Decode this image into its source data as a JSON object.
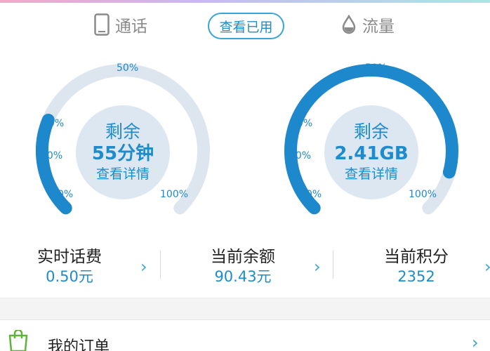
{
  "header": {
    "call_tab": {
      "label": "通话",
      "icon": "phone-icon"
    },
    "view_used_button": "查看已用",
    "data_tab": {
      "label": "流量",
      "icon": "droplet-icon"
    }
  },
  "colors": {
    "accent": "#1e88cc",
    "track": "#dde6ef",
    "center": "#dce7f1"
  },
  "gauges": [
    {
      "title": "剩余",
      "value": "55分钟",
      "link": "查看详情",
      "ticks": {
        "t0": "0%",
        "t10": "10%",
        "t20": "20%",
        "t50": "50%",
        "t100": "100%"
      },
      "remaining_fraction": 0.25
    },
    {
      "title": "剩余",
      "value": "2.41GB",
      "link": "查看详情",
      "ticks": {
        "t0": "0%",
        "t10": "10%",
        "t20": "20%",
        "t50": "50%",
        "t100": "100%"
      },
      "remaining_fraction": 0.89
    }
  ],
  "stats": [
    {
      "label": "实时话费",
      "value": "0.50元"
    },
    {
      "label": "当前余额",
      "value": "90.43元"
    },
    {
      "label": "当前积分",
      "value": "2352"
    }
  ],
  "menu": {
    "orders": {
      "label": "我的订单",
      "icon": "shopping-bag-icon"
    }
  }
}
